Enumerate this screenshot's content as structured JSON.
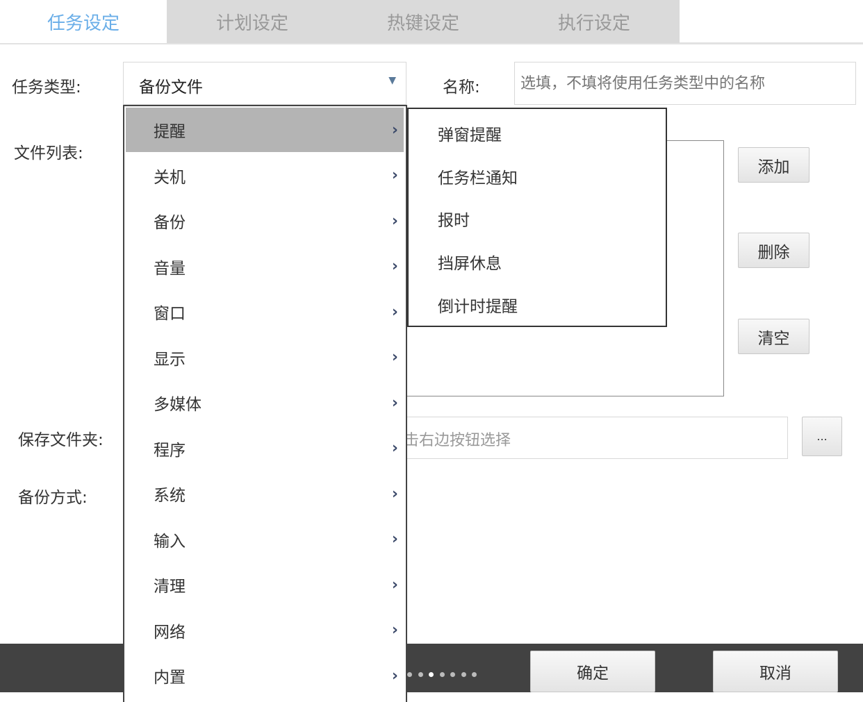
{
  "tabs": [
    "任务设定",
    "计划设定",
    "热键设定",
    "执行设定"
  ],
  "form": {
    "task_type_label": "任务类型:",
    "task_type_value": "备份文件",
    "name_label": "名称:",
    "name_placeholder": "选填，不填将使用任务类型中的名称",
    "file_list_label": "文件列表:",
    "add": "添加",
    "delete": "删除",
    "clear": "清空",
    "save_folder_label": "保存文件夹:",
    "save_folder_placeholder": "击右边按钮选择",
    "browse": "...",
    "backup_mode_label": "备份方式:"
  },
  "menu": [
    "提醒",
    "关机",
    "备份",
    "音量",
    "窗口",
    "显示",
    "多媒体",
    "程序",
    "系统",
    "输入",
    "清理",
    "网络",
    "内置"
  ],
  "submenu": [
    "弹窗提醒",
    "任务栏通知",
    "报时",
    "挡屏休息",
    "倒计时提醒"
  ],
  "footer": {
    "ok": "确定",
    "cancel": "取消",
    "page_count": 7,
    "active_page": 3
  }
}
